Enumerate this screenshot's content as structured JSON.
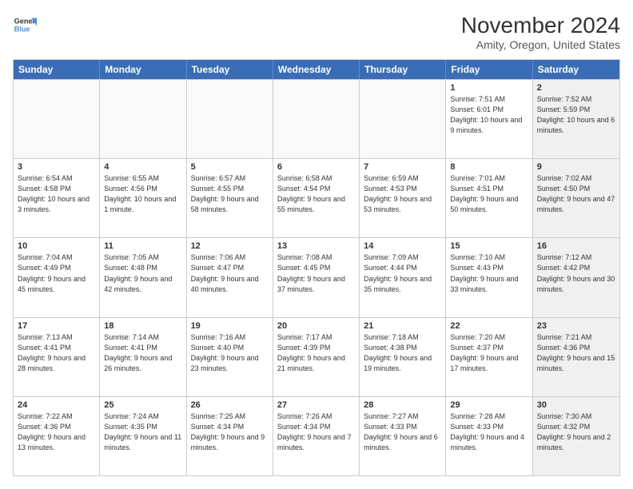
{
  "logo": {
    "line1": "General",
    "line2": "Blue"
  },
  "title": "November 2024",
  "location": "Amity, Oregon, United States",
  "days": [
    "Sunday",
    "Monday",
    "Tuesday",
    "Wednesday",
    "Thursday",
    "Friday",
    "Saturday"
  ],
  "weeks": [
    [
      {
        "num": "",
        "info": ""
      },
      {
        "num": "",
        "info": ""
      },
      {
        "num": "",
        "info": ""
      },
      {
        "num": "",
        "info": ""
      },
      {
        "num": "",
        "info": ""
      },
      {
        "num": "1",
        "info": "Sunrise: 7:51 AM\nSunset: 6:01 PM\nDaylight: 10 hours and 9 minutes."
      },
      {
        "num": "2",
        "info": "Sunrise: 7:52 AM\nSunset: 5:59 PM\nDaylight: 10 hours and 6 minutes."
      }
    ],
    [
      {
        "num": "3",
        "info": "Sunrise: 6:54 AM\nSunset: 4:58 PM\nDaylight: 10 hours and 3 minutes."
      },
      {
        "num": "4",
        "info": "Sunrise: 6:55 AM\nSunset: 4:56 PM\nDaylight: 10 hours and 1 minute."
      },
      {
        "num": "5",
        "info": "Sunrise: 6:57 AM\nSunset: 4:55 PM\nDaylight: 9 hours and 58 minutes."
      },
      {
        "num": "6",
        "info": "Sunrise: 6:58 AM\nSunset: 4:54 PM\nDaylight: 9 hours and 55 minutes."
      },
      {
        "num": "7",
        "info": "Sunrise: 6:59 AM\nSunset: 4:53 PM\nDaylight: 9 hours and 53 minutes."
      },
      {
        "num": "8",
        "info": "Sunrise: 7:01 AM\nSunset: 4:51 PM\nDaylight: 9 hours and 50 minutes."
      },
      {
        "num": "9",
        "info": "Sunrise: 7:02 AM\nSunset: 4:50 PM\nDaylight: 9 hours and 47 minutes."
      }
    ],
    [
      {
        "num": "10",
        "info": "Sunrise: 7:04 AM\nSunset: 4:49 PM\nDaylight: 9 hours and 45 minutes."
      },
      {
        "num": "11",
        "info": "Sunrise: 7:05 AM\nSunset: 4:48 PM\nDaylight: 9 hours and 42 minutes."
      },
      {
        "num": "12",
        "info": "Sunrise: 7:06 AM\nSunset: 4:47 PM\nDaylight: 9 hours and 40 minutes."
      },
      {
        "num": "13",
        "info": "Sunrise: 7:08 AM\nSunset: 4:45 PM\nDaylight: 9 hours and 37 minutes."
      },
      {
        "num": "14",
        "info": "Sunrise: 7:09 AM\nSunset: 4:44 PM\nDaylight: 9 hours and 35 minutes."
      },
      {
        "num": "15",
        "info": "Sunrise: 7:10 AM\nSunset: 4:43 PM\nDaylight: 9 hours and 33 minutes."
      },
      {
        "num": "16",
        "info": "Sunrise: 7:12 AM\nSunset: 4:42 PM\nDaylight: 9 hours and 30 minutes."
      }
    ],
    [
      {
        "num": "17",
        "info": "Sunrise: 7:13 AM\nSunset: 4:41 PM\nDaylight: 9 hours and 28 minutes."
      },
      {
        "num": "18",
        "info": "Sunrise: 7:14 AM\nSunset: 4:41 PM\nDaylight: 9 hours and 26 minutes."
      },
      {
        "num": "19",
        "info": "Sunrise: 7:16 AM\nSunset: 4:40 PM\nDaylight: 9 hours and 23 minutes."
      },
      {
        "num": "20",
        "info": "Sunrise: 7:17 AM\nSunset: 4:39 PM\nDaylight: 9 hours and 21 minutes."
      },
      {
        "num": "21",
        "info": "Sunrise: 7:18 AM\nSunset: 4:38 PM\nDaylight: 9 hours and 19 minutes."
      },
      {
        "num": "22",
        "info": "Sunrise: 7:20 AM\nSunset: 4:37 PM\nDaylight: 9 hours and 17 minutes."
      },
      {
        "num": "23",
        "info": "Sunrise: 7:21 AM\nSunset: 4:36 PM\nDaylight: 9 hours and 15 minutes."
      }
    ],
    [
      {
        "num": "24",
        "info": "Sunrise: 7:22 AM\nSunset: 4:36 PM\nDaylight: 9 hours and 13 minutes."
      },
      {
        "num": "25",
        "info": "Sunrise: 7:24 AM\nSunset: 4:35 PM\nDaylight: 9 hours and 11 minutes."
      },
      {
        "num": "26",
        "info": "Sunrise: 7:25 AM\nSunset: 4:34 PM\nDaylight: 9 hours and 9 minutes."
      },
      {
        "num": "27",
        "info": "Sunrise: 7:26 AM\nSunset: 4:34 PM\nDaylight: 9 hours and 7 minutes."
      },
      {
        "num": "28",
        "info": "Sunrise: 7:27 AM\nSunset: 4:33 PM\nDaylight: 9 hours and 6 minutes."
      },
      {
        "num": "29",
        "info": "Sunrise: 7:28 AM\nSunset: 4:33 PM\nDaylight: 9 hours and 4 minutes."
      },
      {
        "num": "30",
        "info": "Sunrise: 7:30 AM\nSunset: 4:32 PM\nDaylight: 9 hours and 2 minutes."
      }
    ]
  ]
}
